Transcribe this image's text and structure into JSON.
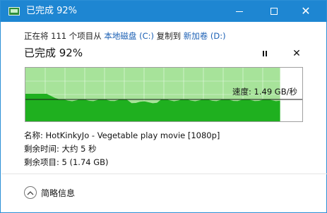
{
  "window": {
    "title": "已完成 92%"
  },
  "status": {
    "prefix": "正在将 111 个项目从",
    "source": "本地磁盘 (C:)",
    "middle": "复制到",
    "destination": "新加卷 (D:)"
  },
  "progress": {
    "title": "已完成 92%",
    "percent": 92,
    "speed_label": "速度: 1.49 GB/秒"
  },
  "details": {
    "name_label": "名称: HotKinkyJo - Vegetable play movie [1080p]",
    "time_label": "剩余时间: 大约 5 秒",
    "items_label": "剩余项目: 5 (1.74 GB)"
  },
  "footer": {
    "collapse_label": "简略信息"
  },
  "colors": {
    "accent": "#1e86d2",
    "progress_fill": "#a7e39a",
    "throughput_fill": "#1fb01f",
    "link": "#1a5fb4"
  }
}
